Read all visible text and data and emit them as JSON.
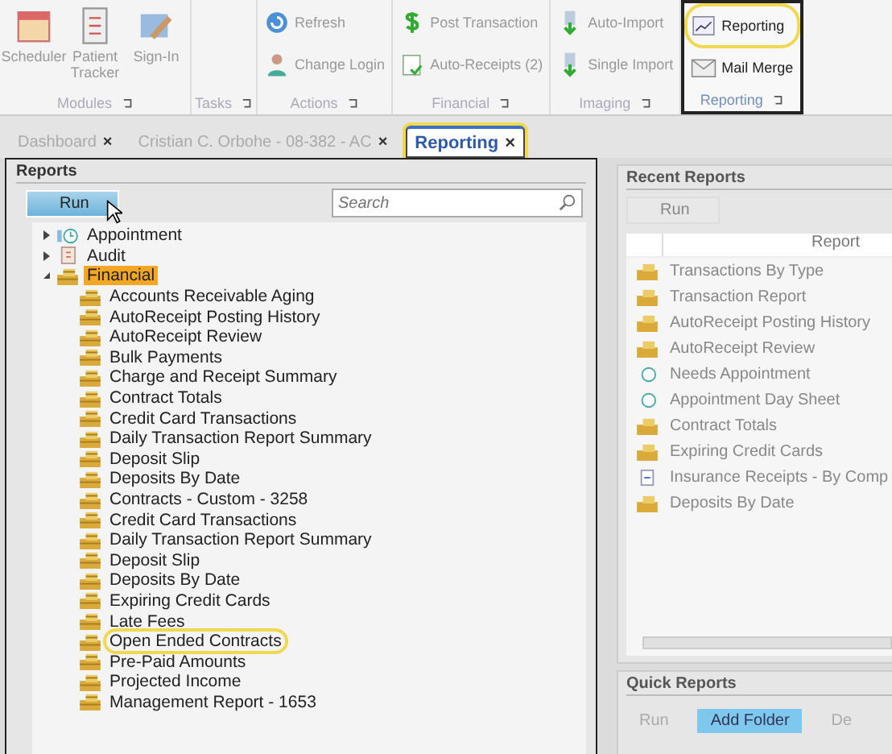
{
  "ribbon": {
    "groups": [
      {
        "label": "Modules",
        "kind": "large",
        "highlighted": false,
        "buttons": [
          {
            "label": "Scheduler",
            "kind": "calendar",
            "highlighted": false
          },
          {
            "label": "Patient Tracker",
            "kind": "list",
            "highlighted": false
          },
          {
            "label": "Sign-In",
            "kind": "pen",
            "highlighted": false
          }
        ]
      },
      {
        "label": "Tasks",
        "kind": "small",
        "highlighted": false
      },
      {
        "label": "Actions",
        "kind": "small",
        "highlighted": false,
        "buttons": [
          {
            "label": "Refresh",
            "kind": "refresh",
            "highlighted": false
          },
          {
            "label": "Change Login",
            "kind": "person",
            "highlighted": false
          }
        ]
      },
      {
        "label": "Financial",
        "kind": "small",
        "highlighted": false,
        "buttons": [
          {
            "label": "Post Transaction",
            "kind": "dollar",
            "highlighted": false
          },
          {
            "label": "Auto-Receipts (2)",
            "kind": "receipt",
            "highlighted": false
          }
        ]
      },
      {
        "label": "Imaging",
        "kind": "small",
        "highlighted": false,
        "buttons": [
          {
            "label": "Auto-Import",
            "kind": "import",
            "highlighted": false
          },
          {
            "label": "Single Import",
            "kind": "import",
            "highlighted": false
          }
        ]
      },
      {
        "label": "Reporting",
        "kind": "small",
        "highlighted": true,
        "buttons": [
          {
            "label": "Reporting",
            "kind": "report",
            "highlighted": true
          },
          {
            "label": "Mail Merge",
            "kind": "envelope",
            "highlighted": false
          }
        ]
      }
    ]
  },
  "tabs": [
    {
      "label": "Dashboard",
      "close": "×",
      "selected": false,
      "highlighted": false
    },
    {
      "label": "Cristian C. Orbohe - 08-382 - AC",
      "close": "×",
      "selected": false,
      "highlighted": false
    },
    {
      "label": "Reporting",
      "close": "×",
      "selected": true,
      "highlighted": true
    }
  ],
  "reports": {
    "title": "Reports",
    "run_button": "Run",
    "search": {
      "placeholder": "Search"
    },
    "tree": [
      {
        "label": "Appointment",
        "kind": "appointment",
        "expanded": false,
        "selected": false,
        "highlighted": false
      },
      {
        "label": "Audit",
        "kind": "audit",
        "expanded": false,
        "selected": false,
        "highlighted": false
      },
      {
        "label": "Financial",
        "kind": "financial",
        "expanded": true,
        "selected": true,
        "highlighted": false,
        "children": [
          {
            "label": "Accounts Receivable Aging",
            "kind": "financial",
            "selected": false,
            "highlighted": false
          },
          {
            "label": "AutoReceipt Posting History",
            "kind": "financial",
            "selected": false,
            "highlighted": false
          },
          {
            "label": "AutoReceipt Review",
            "kind": "financial",
            "selected": false,
            "highlighted": false
          },
          {
            "label": "Bulk Payments",
            "kind": "financial",
            "selected": false,
            "highlighted": false
          },
          {
            "label": "Charge and Receipt Summary",
            "kind": "financial",
            "selected": false,
            "highlighted": false
          },
          {
            "label": "Contract Totals",
            "kind": "financial",
            "selected": false,
            "highlighted": false
          },
          {
            "label": "Credit Card Transactions",
            "kind": "financial",
            "selected": false,
            "highlighted": false
          },
          {
            "label": "Daily Transaction Report Summary",
            "kind": "financial",
            "selected": false,
            "highlighted": false
          },
          {
            "label": "Deposit Slip",
            "kind": "financial",
            "selected": false,
            "highlighted": false
          },
          {
            "label": "Deposits By Date",
            "kind": "financial",
            "selected": false,
            "highlighted": false
          },
          {
            "label": "Contracts - Custom - 3258",
            "kind": "financial",
            "selected": false,
            "highlighted": false
          },
          {
            "label": "Credit Card Transactions",
            "kind": "financial",
            "selected": false,
            "highlighted": false
          },
          {
            "label": "Daily Transaction Report Summary",
            "kind": "financial",
            "selected": false,
            "highlighted": false
          },
          {
            "label": "Deposit Slip",
            "kind": "financial",
            "selected": false,
            "highlighted": false
          },
          {
            "label": "Deposits By Date",
            "kind": "financial",
            "selected": false,
            "highlighted": false
          },
          {
            "label": "Expiring Credit Cards",
            "kind": "financial",
            "selected": false,
            "highlighted": false
          },
          {
            "label": "Late Fees",
            "kind": "financial",
            "selected": false,
            "highlighted": false
          },
          {
            "label": "Open Ended Contracts",
            "kind": "financial",
            "selected": false,
            "highlighted": true
          },
          {
            "label": "Pre-Paid Amounts",
            "kind": "financial",
            "selected": false,
            "highlighted": false
          },
          {
            "label": "Projected Income",
            "kind": "financial",
            "selected": false,
            "highlighted": false
          },
          {
            "label": "Management Report - 1653",
            "kind": "financial",
            "selected": false,
            "highlighted": false
          }
        ]
      }
    ]
  },
  "recent_reports": {
    "title": "Recent Reports",
    "run_button": "Run",
    "column": "Report",
    "rows": [
      {
        "label": "Transactions By Type",
        "kind": "financial"
      },
      {
        "label": "Transaction Report",
        "kind": "financial"
      },
      {
        "label": "AutoReceipt Posting History",
        "kind": "financial"
      },
      {
        "label": "AutoReceipt Review",
        "kind": "financial"
      },
      {
        "label": "Needs Appointment",
        "kind": "appointment"
      },
      {
        "label": "Appointment Day Sheet",
        "kind": "appointment"
      },
      {
        "label": "Contract Totals",
        "kind": "financial"
      },
      {
        "label": "Expiring Credit Cards",
        "kind": "financial"
      },
      {
        "label": "Insurance Receipts - By Comp",
        "kind": "insurance"
      },
      {
        "label": "Deposits By Date",
        "kind": "financial"
      }
    ]
  },
  "quick_reports": {
    "title": "Quick Reports",
    "buttons": [
      {
        "label": "Run",
        "highlighted": false
      },
      {
        "label": "Add Folder",
        "highlighted": true
      },
      {
        "label": "De",
        "highlighted": false
      }
    ]
  }
}
